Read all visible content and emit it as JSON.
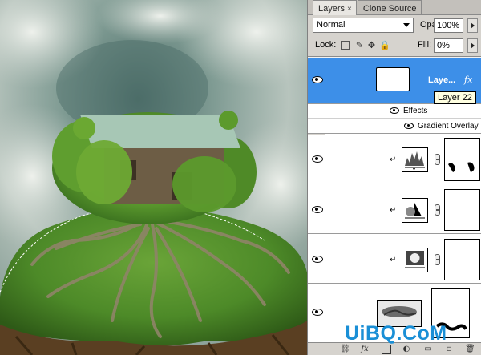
{
  "tabs": [
    {
      "label": "Layers",
      "close": "×",
      "active": true
    },
    {
      "label": "Clone Source",
      "active": false
    }
  ],
  "blend_mode": "Normal",
  "opacity": {
    "label": "Opacity:",
    "value": "100%"
  },
  "lock": {
    "label": "Lock:"
  },
  "fill": {
    "label": "Fill:",
    "value": "0%"
  },
  "layers": [
    {
      "name": "Laye...",
      "fx": "fx",
      "visible": true,
      "selected": true
    },
    {
      "name": "",
      "visible": true,
      "clipped": true,
      "thumb": "levels-icon"
    },
    {
      "name": "",
      "visible": true,
      "clipped": true,
      "thumb": "curves-icon"
    },
    {
      "name": "",
      "visible": true,
      "clipped": true,
      "thumb": "exposure-icon"
    },
    {
      "name": "",
      "visible": true,
      "clipped": false,
      "thumb": "tree-roots-photo"
    }
  ],
  "effects": {
    "label": "Effects",
    "items": [
      "Gradient Overlay"
    ]
  },
  "tooltip": "Layer 22",
  "watermark": "UiBQ.CoM",
  "colors": {
    "selection": "#3d8fe8",
    "sky": "#6f8c84",
    "grass": "#4f8a2a"
  }
}
